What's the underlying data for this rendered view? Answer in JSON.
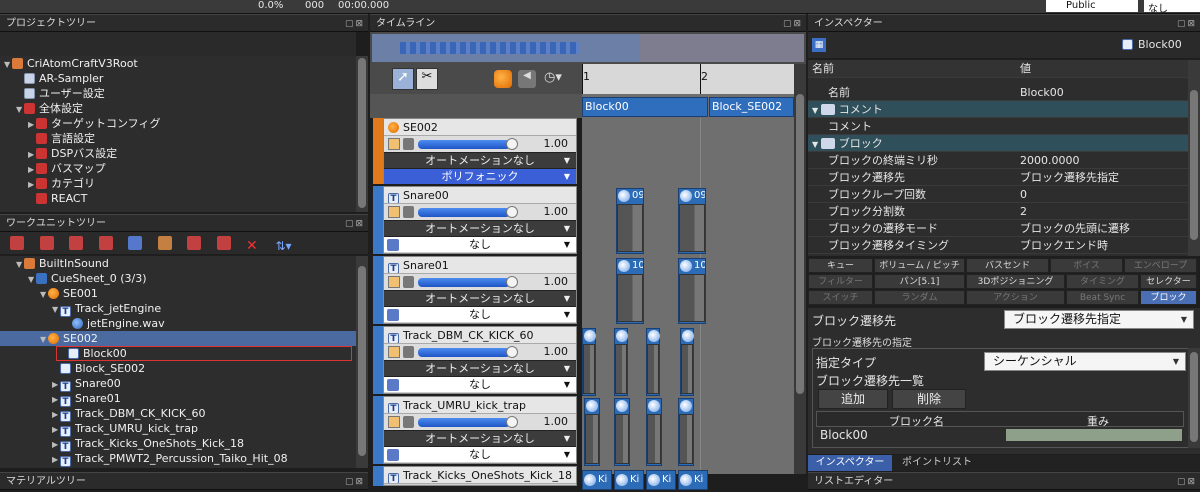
{
  "toolbar": {
    "progress": "0.0%",
    "count": "000",
    "time": "00:00.000",
    "profile": "Public",
    "none": "なし"
  },
  "panels": {
    "project_tree": "プロジェクトツリー",
    "workunit_tree": "ワークユニットツリー",
    "material_tree": "マテリアルツリー",
    "timeline": "タイムライン",
    "inspector": "インスペクター",
    "list_editor": "リストエディター"
  },
  "project_tree": [
    {
      "label": "CriAtomCraftV3Root",
      "icon": "folder",
      "depth": 0,
      "tri": "▼"
    },
    {
      "label": "AR-Sampler",
      "icon": "doc",
      "depth": 1,
      "tri": ""
    },
    {
      "label": "ユーザー設定",
      "icon": "doc",
      "depth": 1,
      "tri": ""
    },
    {
      "label": "全体設定",
      "icon": "folderred",
      "depth": 1,
      "tri": "▼"
    },
    {
      "label": "ターゲットコンフィグ",
      "icon": "folderred",
      "depth": 2,
      "tri": "▶"
    },
    {
      "label": "言語設定",
      "icon": "folderred",
      "depth": 2,
      "tri": ""
    },
    {
      "label": "DSPバス設定",
      "icon": "folderred",
      "depth": 2,
      "tri": "▶"
    },
    {
      "label": "バスマップ",
      "icon": "folderred",
      "depth": 2,
      "tri": "▶"
    },
    {
      "label": "カテゴリ",
      "icon": "folderred",
      "depth": 2,
      "tri": "▶"
    },
    {
      "label": "REACT",
      "icon": "folderred",
      "depth": 2,
      "tri": ""
    }
  ],
  "workunit_tree": [
    {
      "label": "BuiltInSound",
      "icon": "folder",
      "depth": 1,
      "tri": "▼"
    },
    {
      "label": "CueSheet_0 (3/3)",
      "icon": "cue",
      "depth": 2,
      "tri": "▼"
    },
    {
      "label": "SE001",
      "icon": "se",
      "depth": 3,
      "tri": "▼"
    },
    {
      "label": "Track_jetEngine",
      "icon": "T",
      "depth": 4,
      "tri": "▼"
    },
    {
      "label": "jetEngine.wav",
      "icon": "wave",
      "depth": 5,
      "tri": ""
    },
    {
      "label": "SE002",
      "icon": "se",
      "depth": 3,
      "tri": "▼",
      "highlight": true
    },
    {
      "label": "Block00",
      "icon": "blk",
      "depth": 4,
      "tri": "",
      "boxed": true
    },
    {
      "label": "Block_SE002",
      "icon": "blk",
      "depth": 4,
      "tri": ""
    },
    {
      "label": "Snare00",
      "icon": "T",
      "depth": 4,
      "tri": "▶"
    },
    {
      "label": "Snare01",
      "icon": "T",
      "depth": 4,
      "tri": "▶"
    },
    {
      "label": "Track_DBM_CK_KICK_60",
      "icon": "T",
      "depth": 4,
      "tri": "▶"
    },
    {
      "label": "Track_UMRU_kick_trap",
      "icon": "T",
      "depth": 4,
      "tri": "▶"
    },
    {
      "label": "Track_Kicks_OneShots_Kick_18",
      "icon": "T",
      "depth": 4,
      "tri": "▶"
    },
    {
      "label": "Track_PMWT2_Percussion_Taiko_Hit_08",
      "icon": "T",
      "depth": 4,
      "tri": "▶"
    }
  ],
  "timeline": {
    "ruler": [
      "1",
      "2"
    ],
    "blocks": [
      "Block00",
      "Block_SE002"
    ],
    "cue": {
      "name": "SE002",
      "volume": "1.00",
      "automation": "オートメーションなし",
      "mode": "ポリフォニック"
    },
    "tracks": [
      {
        "name": "Snare00",
        "volume": "1.00",
        "automation": "オートメーションなし",
        "option": "なし",
        "clips": [
          "09",
          "09"
        ]
      },
      {
        "name": "Snare01",
        "volume": "1.00",
        "automation": "オートメーションなし",
        "option": "なし",
        "clips": [
          "10",
          "10"
        ]
      },
      {
        "name": "Track_DBM_CK_KICK_60",
        "volume": "1.00",
        "automation": "オートメーションなし",
        "option": "なし",
        "clips": []
      },
      {
        "name": "Track_UMRU_kick_trap",
        "volume": "1.00",
        "automation": "オートメーションなし",
        "option": "なし",
        "clips": []
      },
      {
        "name": "Track_Kicks_OneShots_Kick_18",
        "volume": "",
        "automation": "",
        "option": "",
        "clips": [
          "Ki",
          "Ki",
          "Ki",
          "Ki"
        ]
      }
    ]
  },
  "inspector": {
    "selected": "Block00",
    "col_name": "名前",
    "col_value": "値",
    "rows": [
      {
        "k": "名前",
        "v": "Block00",
        "type": "row"
      },
      {
        "k": "コメント",
        "v": "",
        "type": "section"
      },
      {
        "k": "コメント",
        "v": "",
        "type": "row"
      },
      {
        "k": "ブロック",
        "v": "",
        "type": "section"
      },
      {
        "k": "ブロックの終端ミリ秒",
        "v": "2000.0000",
        "type": "row"
      },
      {
        "k": "ブロック遷移先",
        "v": "ブロック遷移先指定",
        "type": "row"
      },
      {
        "k": "ブロックループ回数",
        "v": "0",
        "type": "row"
      },
      {
        "k": "ブロック分割数",
        "v": "2",
        "type": "row"
      },
      {
        "k": "ブロックの遷移モード",
        "v": "ブロックの先頭に遷移",
        "type": "row"
      },
      {
        "k": "ブロック遷移タイミング",
        "v": "ブロックエンド時",
        "type": "row"
      }
    ],
    "tabs_row1": [
      "キュー",
      "ボリューム / ピッチ",
      "バスセンド",
      "ボイス",
      "エンベロープ"
    ],
    "tabs_row2": [
      "フィルター",
      "パン[5.1]",
      "3Dポジショニング",
      "タイミング",
      "セレクター"
    ],
    "tabs_row3": [
      "スイッチ",
      "ランダム",
      "アクション",
      "Beat Sync",
      "ブロック"
    ],
    "transition_label": "ブロック遷移先",
    "transition_value": "ブロック遷移先指定",
    "group_label": "ブロック遷移先の指定",
    "spec_type_label": "指定タイプ",
    "spec_type_value": "シーケンシャル",
    "list_label": "ブロック遷移先一覧",
    "add": "追加",
    "delete": "削除",
    "table_h1": "ブロック名",
    "table_h2": "重み",
    "table_rows": [
      {
        "name": "Block00",
        "weight": ""
      }
    ],
    "bottom_tabs": [
      "インスペクター",
      "ポイントリスト"
    ]
  },
  "colors": {
    "accent": "#3b5fd6",
    "clip": "#2c6bb5",
    "se_orange": "#e07a1a"
  }
}
